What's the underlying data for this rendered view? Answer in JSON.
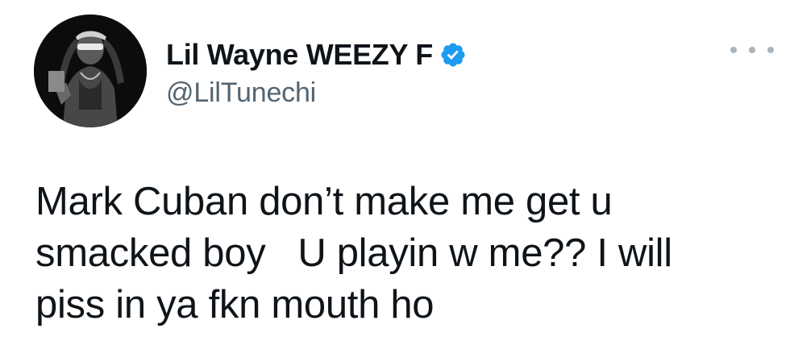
{
  "author": {
    "display_name": "Lil Wayne WEEZY F",
    "handle": "@LilTunechi",
    "verified": true,
    "avatar_icon": "profile-photo",
    "verified_icon": "verified-badge-icon"
  },
  "tweet": {
    "text": "Mark Cuban don’t make me get u\nsmacked boy   U playin w me?? I will\npiss in ya fkn mouth ho"
  },
  "menu": {
    "icon": "more-options-icon"
  },
  "colors": {
    "text": "#0f1419",
    "secondary": "#536471",
    "verified": "#1d9bf0",
    "background": "#ffffff"
  }
}
